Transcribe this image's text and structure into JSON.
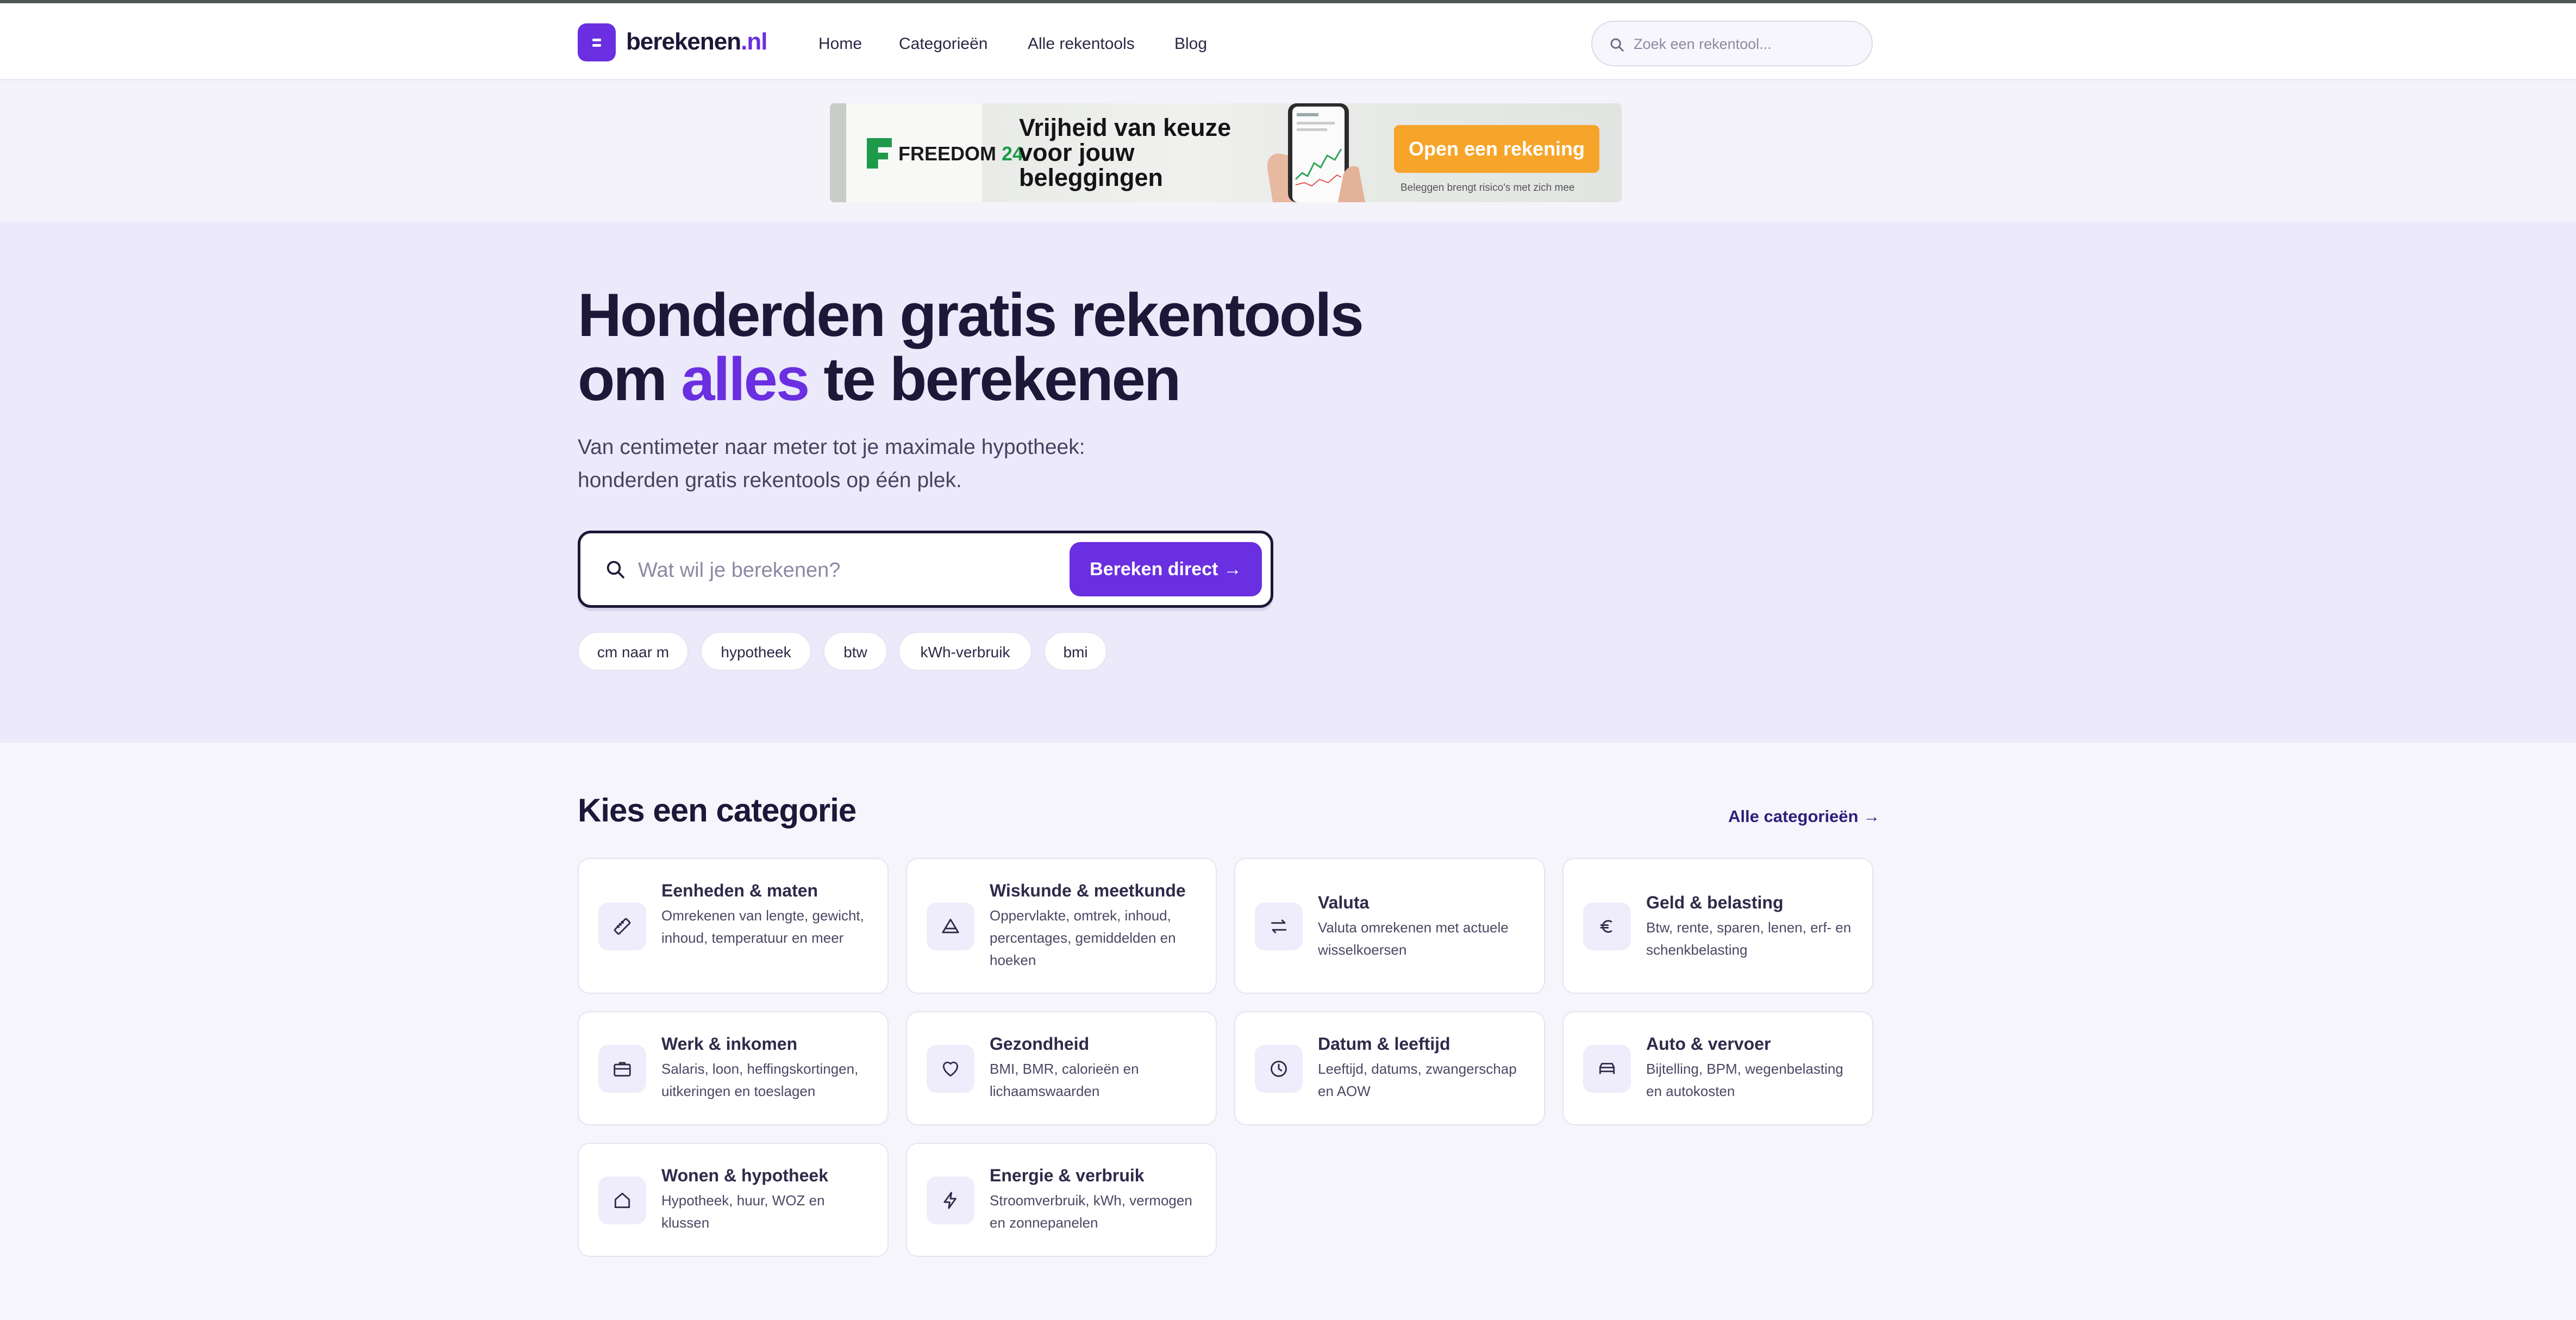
{
  "header": {
    "logo": {
      "name": "berekenen",
      "tld": ".nl"
    },
    "nav": [
      "Home",
      "Categorieën",
      "Alle rekentools",
      "Blog"
    ],
    "search_placeholder": "Zoek een rekentool..."
  },
  "ad": {
    "brand": "FREEDOM",
    "brand_number": " 24",
    "headline": "Vrijheid van keuze voor jouw beleggingen",
    "cta": "Open een rekening",
    "disclaimer": "Beleggen brengt risico's met zich mee"
  },
  "hero": {
    "title_line1": "Honderden gratis rekentools",
    "title_line2_before": "om ",
    "title_line2_accent": "alles",
    "title_line2_after": " te berekenen",
    "subtitle_line1": "Van centimeter naar meter tot je maximale hypotheek:",
    "subtitle_line2": "honderden gratis rekentools op één plek.",
    "search_placeholder": "Wat wil je berekenen?",
    "search_button": "Bereken direct →",
    "chips": [
      "cm naar m",
      "hypotheek",
      "btw",
      "kWh-verbruik",
      "bmi"
    ]
  },
  "categories": {
    "title": "Kies een categorie",
    "all_link": "Alle categorieën →",
    "items": [
      {
        "title": "Eenheden & maten",
        "desc": "Omrekenen van lengte, gewicht, inhoud, temperatuur en meer",
        "icon": "ruler-icon"
      },
      {
        "title": "Wiskunde & meetkunde",
        "desc": "Oppervlakte, omtrek, inhoud, percentages, gemiddelden en hoeken",
        "icon": "triangle-icon"
      },
      {
        "title": "Valuta",
        "desc": "Valuta omrekenen met actuele wisselkoersen",
        "icon": "exchange-arrows-icon"
      },
      {
        "title": "Geld & belasting",
        "desc": "Btw, rente, sparen, lenen, erf- en schenkbelasting",
        "icon": "euro-icon"
      },
      {
        "title": "Werk & inkomen",
        "desc": "Salaris, loon, heffingskortingen, uitkeringen en toeslagen",
        "icon": "briefcase-icon"
      },
      {
        "title": "Gezondheid",
        "desc": "BMI, BMR, calorieën en lichaamswaarden",
        "icon": "heart-icon"
      },
      {
        "title": "Datum & leeftijd",
        "desc": "Leeftijd, datums, zwangerschap en AOW",
        "icon": "clock-icon"
      },
      {
        "title": "Auto & vervoer",
        "desc": "Bijtelling, BPM, wegenbelasting en autokosten",
        "icon": "car-icon"
      },
      {
        "title": "Wonen & hypotheek",
        "desc": "Hypotheek, huur, WOZ en klussen",
        "icon": "house-icon"
      },
      {
        "title": "Energie & verbruik",
        "desc": "Stroomverbruik, kWh, vermogen en zonnepanelen",
        "icon": "lightning-icon"
      }
    ]
  },
  "colors": {
    "accent": "#6a2fe0",
    "dark": "#1b1838",
    "hero_bg": "#ece9fa",
    "ad_cta": "#f6a52a",
    "ad_brand": "#1e9a4b"
  }
}
